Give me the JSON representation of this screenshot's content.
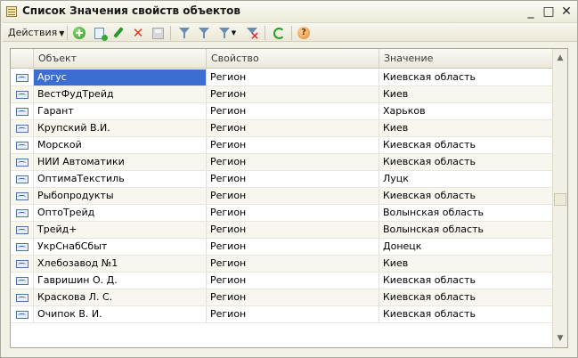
{
  "window": {
    "title": "Список Значения свойств объектов"
  },
  "toolbar": {
    "actions_label": "Действия"
  },
  "table": {
    "columns": [
      "Объект",
      "Свойство",
      "Значение"
    ],
    "rows": [
      {
        "object": "Аргус",
        "property": "Регион",
        "value": "Киевская область"
      },
      {
        "object": "ВестФудТрейд",
        "property": "Регион",
        "value": "Киев"
      },
      {
        "object": "Гарант",
        "property": "Регион",
        "value": "Харьков"
      },
      {
        "object": "Крупский В.И.",
        "property": "Регион",
        "value": "Киев"
      },
      {
        "object": "Морской",
        "property": "Регион",
        "value": "Киевская область"
      },
      {
        "object": "НИИ Автоматики",
        "property": "Регион",
        "value": "Киевская область"
      },
      {
        "object": "ОптимаТекстиль",
        "property": "Регион",
        "value": "Луцк"
      },
      {
        "object": "Рыбопродукты",
        "property": "Регион",
        "value": "Киевская область"
      },
      {
        "object": "ОптоТрейд",
        "property": "Регион",
        "value": "Волынская область"
      },
      {
        "object": "Трейд+",
        "property": "Регион",
        "value": "Волынская область"
      },
      {
        "object": "УкрСнабСбыт",
        "property": "Регион",
        "value": "Донецк"
      },
      {
        "object": "Хлебозавод №1",
        "property": "Регион",
        "value": "Киев"
      },
      {
        "object": "Гавришин О. Д.",
        "property": "Регион",
        "value": "Киевская область"
      },
      {
        "object": "Краскова Л. С.",
        "property": "Регион",
        "value": "Киевская область"
      },
      {
        "object": "Очипок В. И.",
        "property": "Регион",
        "value": "Киевская область"
      }
    ],
    "selected_row": 0
  },
  "colors": {
    "selection": "#3c6ed1",
    "window_bg": "#f3f1e6"
  }
}
